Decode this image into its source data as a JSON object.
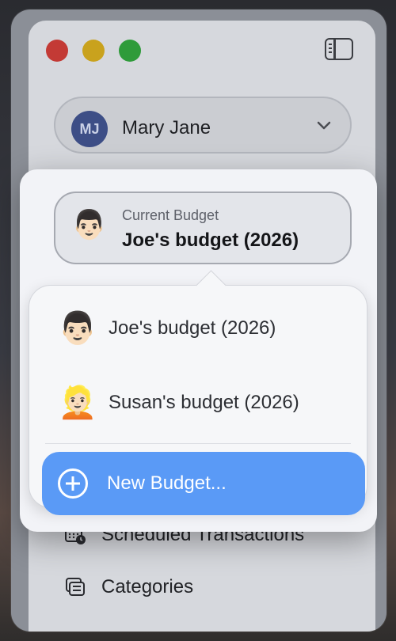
{
  "window": {
    "controls": [
      "close",
      "minimize",
      "zoom"
    ],
    "sidebar_toggle_icon": "sidebar-icon"
  },
  "account": {
    "initials": "MJ",
    "name": "Mary Jane",
    "chevron_icon": "chevron-down-icon"
  },
  "current_budget": {
    "label": "Current Budget",
    "title": "Joe's budget (2026)",
    "face_icon": "man-face-icon"
  },
  "budgets": [
    {
      "label": "Joe's budget (2026)",
      "icon": "man-face-icon"
    },
    {
      "label": "Susan's budget (2026)",
      "icon": "person-face-icon"
    }
  ],
  "new_budget": {
    "label": "New Budget...",
    "icon": "plus-circle-icon"
  },
  "menu": {
    "scheduled": "Scheduled Transactions",
    "categories": "Categories"
  },
  "colors": {
    "accent": "#5a9af6"
  }
}
